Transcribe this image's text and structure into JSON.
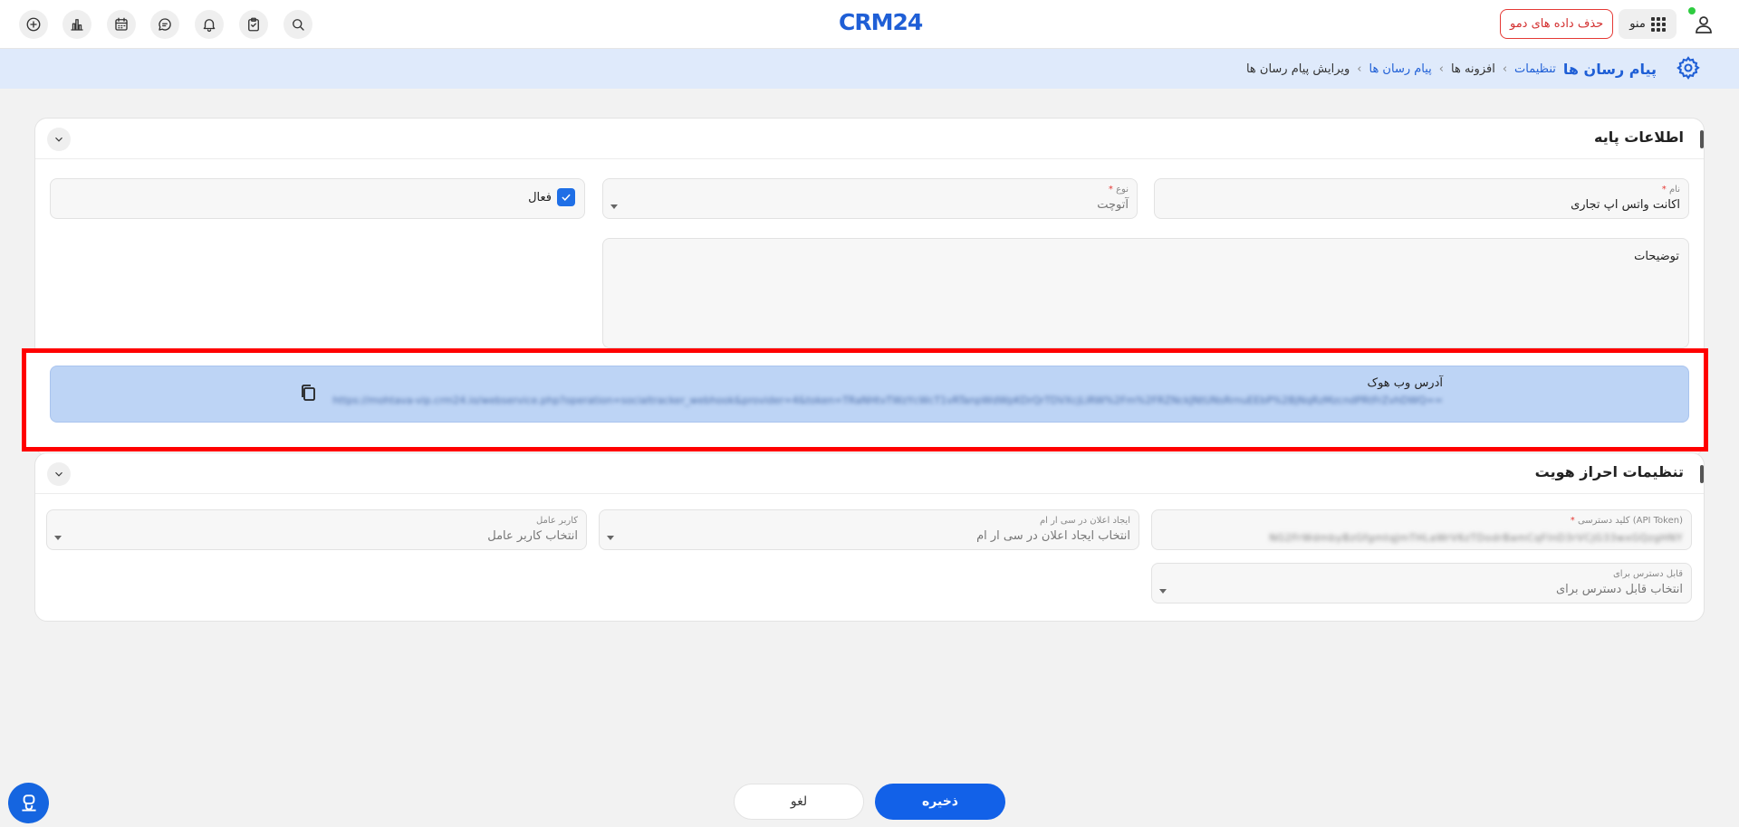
{
  "header": {
    "logo": "CRM24",
    "demo_button": "حذف داده های دمو",
    "menu_label": "منو",
    "icons": [
      "plus-circle-icon",
      "bar-chart-icon",
      "calendar-icon",
      "chat-icon",
      "bell-icon",
      "clipboard-icon",
      "search-icon",
      "user-icon",
      "grid-icon"
    ]
  },
  "breadcrumb": {
    "title": "پیام رسان ها",
    "items": [
      "تنظیمات",
      "افزونه ها",
      "پیام رسان ها",
      "ویرایش پیام رسان ها"
    ]
  },
  "basic_info": {
    "title": "اطلاعات پایه",
    "name_label": "نام",
    "name_value": "اکانت واتس اپ تجاری",
    "type_label": "نوع",
    "type_value": "آتوچت",
    "active_label": "فعال",
    "active_checked": true,
    "description_label": "توضیحات",
    "webhook_label": "آدرس وب هوک",
    "webhook_value": "https://mohtava-vip.crm24.io/webservice.php?operation=socialtracker_webhook&provider=4&token=TRaNHtvTWzYcWcT1vRTanpWdWpKDrQrTDVXcjLiRW%2Fm%2FRZNckJNtUNsRrnuEEbP%2BjNqRzMzcndPRtFrZvhDWQ=="
  },
  "auth_settings": {
    "title": "تنظیمات احراز هویت",
    "api_token_label": "کلید دسترسی (API Token)",
    "api_token_value": "NG2FrWdmbyBzGfgmtqJmTHLaWrV6zTDodrBamCqFInD3rVCjG33wxGQzgHNY",
    "crm_notify_label": "ایجاد اعلان در سی ار ام",
    "crm_notify_placeholder": "انتخاب ایجاد اعلان در سی ار ام",
    "agent_label": "کاربر عامل",
    "agent_placeholder": "انتخاب کاربر عامل",
    "access_label": "قابل دسترس برای",
    "access_placeholder": "انتخاب قابل دسترس برای"
  },
  "actions": {
    "save": "ذخیره",
    "cancel": "لغو"
  },
  "colors": {
    "primary": "#1261e8",
    "breadcrumb_bg": "#dfeafb",
    "highlight": "#ff0000",
    "danger": "#d32f2f"
  }
}
